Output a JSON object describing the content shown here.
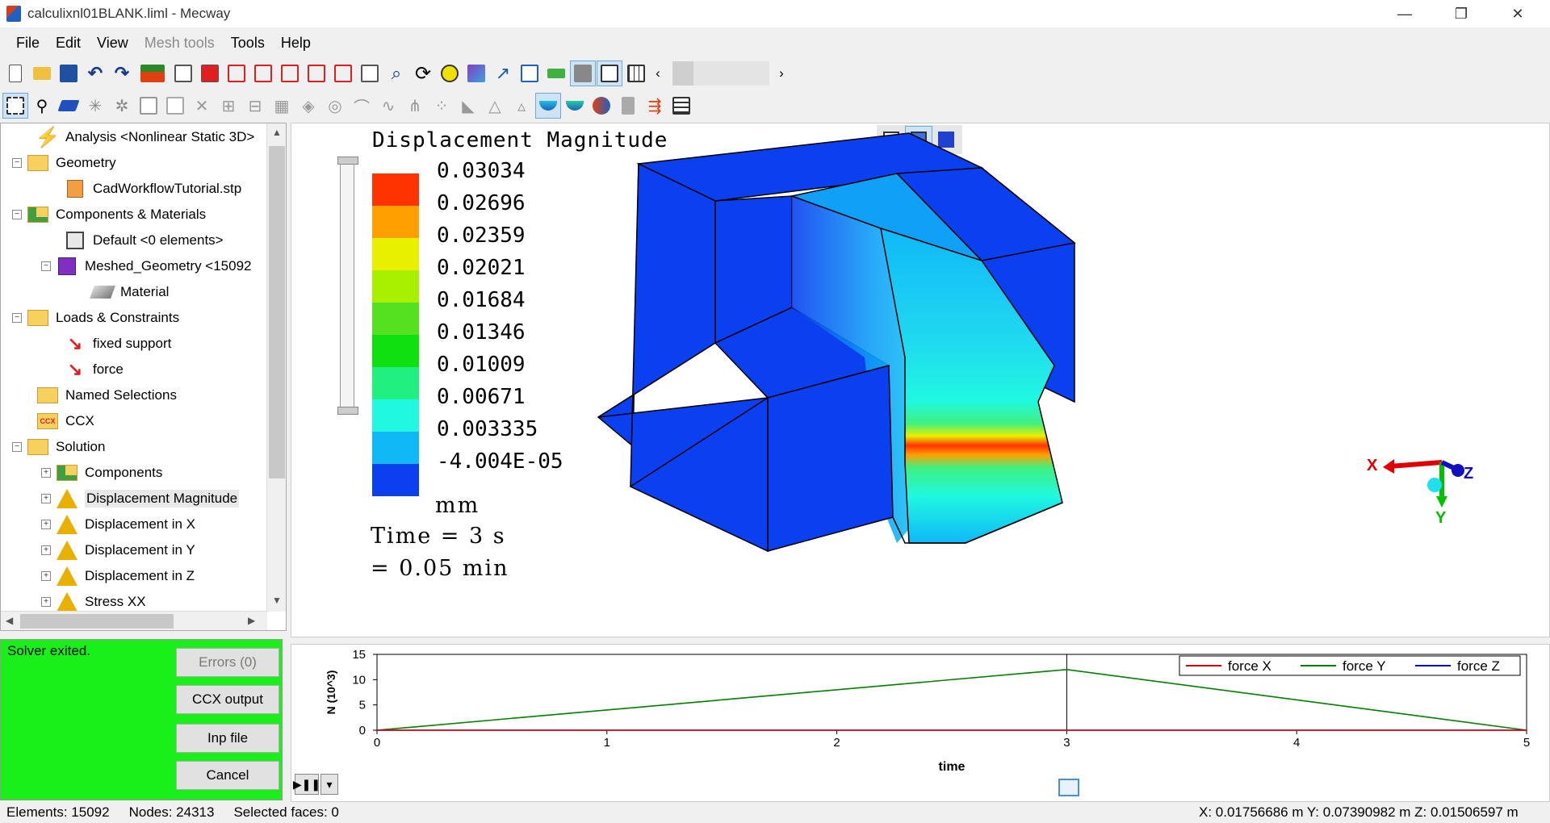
{
  "window": {
    "title": "calculixnl01BLANK.liml - Mecway",
    "minimize": "—",
    "restore": "❐",
    "close": "✕"
  },
  "menu": [
    "File",
    "Edit",
    "View",
    "Mesh tools",
    "Tools",
    "Help"
  ],
  "tree": {
    "items": [
      {
        "label": "Analysis <Nonlinear Static 3D>"
      },
      {
        "label": "Geometry"
      },
      {
        "label": "CadWorkflowTutorial.stp"
      },
      {
        "label": "Components & Materials"
      },
      {
        "label": "Default <0 elements>"
      },
      {
        "label": "Meshed_Geometry <15092"
      },
      {
        "label": "Material"
      },
      {
        "label": "Loads & Constraints"
      },
      {
        "label": "fixed support"
      },
      {
        "label": "force"
      },
      {
        "label": "Named Selections"
      },
      {
        "label": "CCX"
      },
      {
        "label": "Solution"
      },
      {
        "label": "Components"
      },
      {
        "label": "Displacement Magnitude"
      },
      {
        "label": "Displacement in X"
      },
      {
        "label": "Displacement in Y"
      },
      {
        "label": "Displacement in Z"
      },
      {
        "label": "Stress XX"
      }
    ]
  },
  "viewport": {
    "title": "Displacement Magnitude",
    "legend_values": [
      "0.03034",
      "0.02696",
      "0.02359",
      "0.02021",
      "0.01684",
      "0.01346",
      "0.01009",
      "0.00671",
      "0.003335",
      "-4.004E-05"
    ],
    "legend_colors": [
      "#ff3300",
      "#ffa000",
      "#e8f000",
      "#a8f000",
      "#55e020",
      "#10e010",
      "#20f080",
      "#20f8e0",
      "#10b8f8",
      "#0a40f0"
    ],
    "unit": "mm",
    "time_line1": "Time = 3 s",
    "time_line2": "= 0.05 min",
    "triad": {
      "x": "X",
      "y": "Y",
      "z": "Z"
    }
  },
  "solver": {
    "status": "Solver exited.",
    "errors_button": "Errors (0)",
    "ccx_output_button": "CCX output",
    "inp_file_button": "Inp file",
    "cancel_button": "Cancel",
    "background": "#19f019"
  },
  "chart_data": {
    "type": "line",
    "xlabel": "time",
    "ylabel": "N (10^3)",
    "xlim": [
      0,
      5
    ],
    "ylim": [
      0,
      15
    ],
    "xticks": [
      0,
      1,
      2,
      3,
      4,
      5
    ],
    "yticks": [
      0,
      5,
      10,
      15
    ],
    "cursor_x": 3,
    "legend_position": "top-right",
    "series": [
      {
        "name": "force X",
        "color": "#e00000",
        "x": [
          0,
          3,
          5
        ],
        "y": [
          0,
          0,
          0
        ]
      },
      {
        "name": "force Y",
        "color": "#008000",
        "x": [
          0,
          3,
          5
        ],
        "y": [
          0,
          12,
          0
        ]
      },
      {
        "name": "force Z",
        "color": "#0000cc",
        "x": [
          0,
          3,
          5
        ],
        "y": [
          0,
          0,
          0
        ]
      }
    ]
  },
  "status": {
    "elements": "Elements: 15092",
    "nodes": "Nodes: 24313",
    "selected": "Selected faces: 0",
    "coords": "X: 0.01756686 m Y: 0.07390982 m Z: 0.01506597 m"
  }
}
